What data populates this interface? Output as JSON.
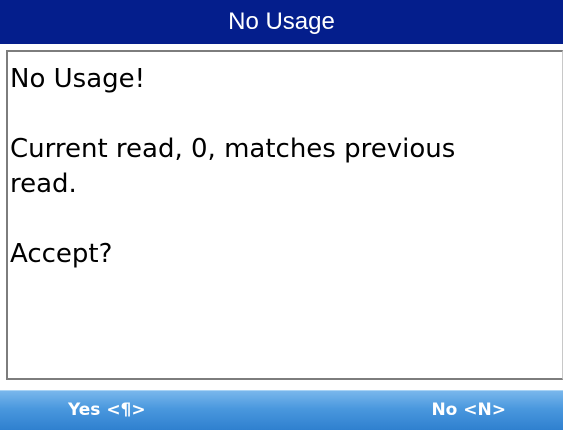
{
  "title": "No Usage",
  "message": {
    "heading": "No Usage!",
    "detail_line1": "Current read, 0, matches previous",
    "detail_line2": "read.",
    "prompt": "Accept?"
  },
  "softkeys": {
    "left_label": "Yes <¶>",
    "right_label": "No <N>"
  },
  "colors": {
    "title_bar": "#041e8c",
    "softkey_bar": "#4a98de",
    "text": "#000000",
    "background": "#ffffff"
  }
}
